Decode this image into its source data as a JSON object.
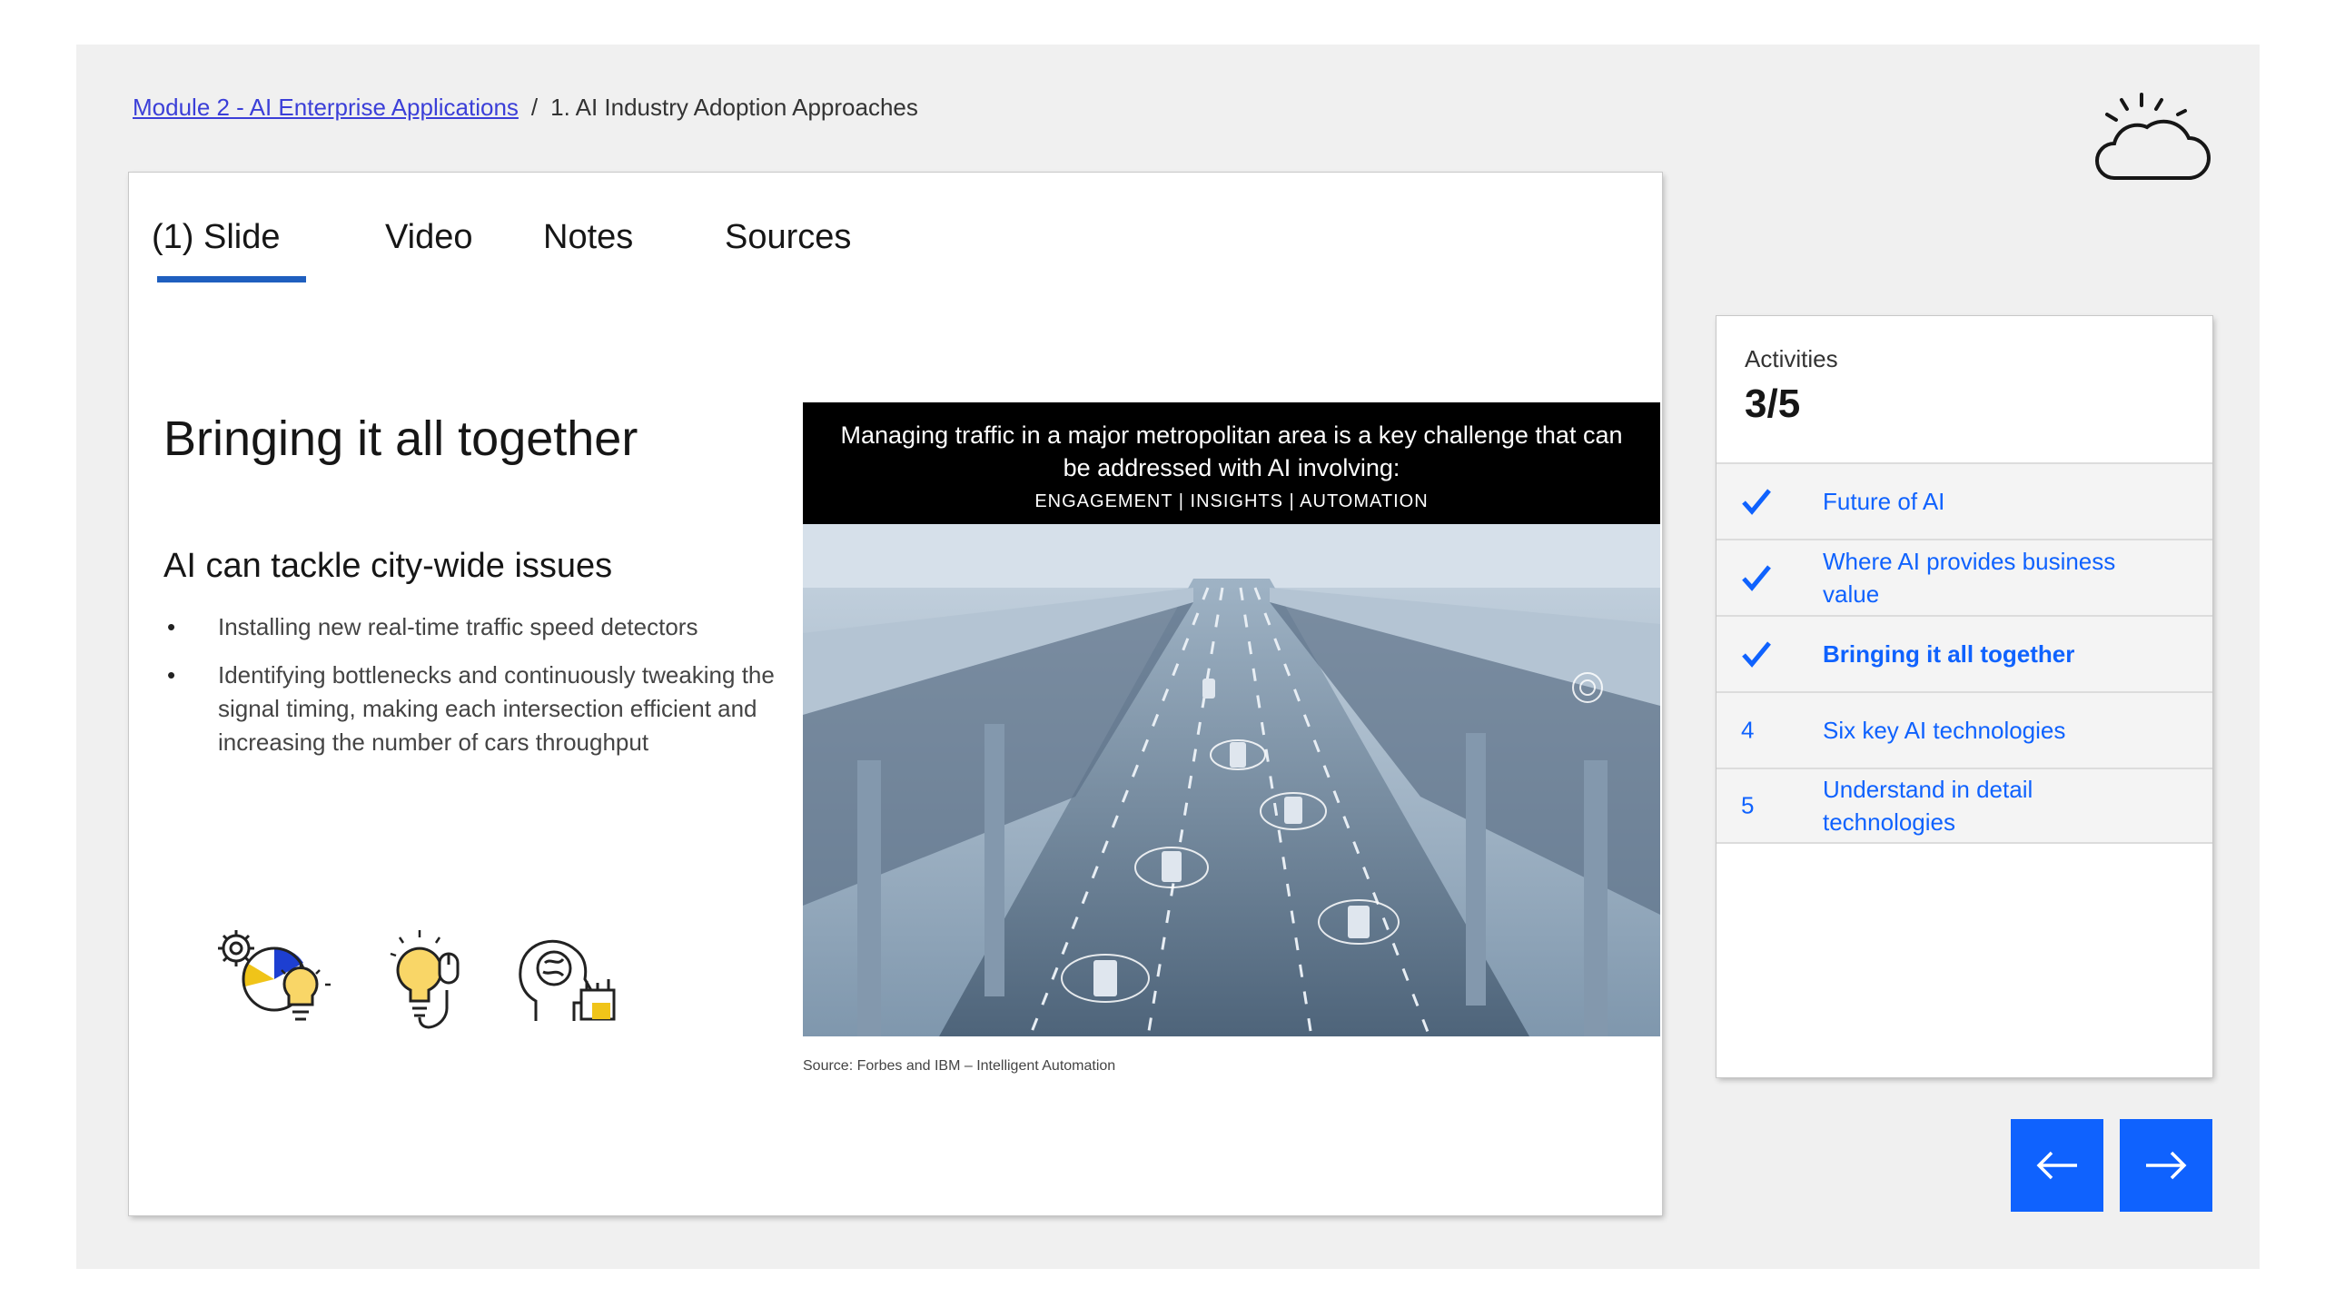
{
  "breadcrumb": {
    "module_link": "Module 2 - AI Enterprise Applications",
    "separator": "/",
    "current": "1. AI Industry Adoption Approaches"
  },
  "tabs": [
    {
      "label": "(1) Slide",
      "active": true
    },
    {
      "label": "Video",
      "active": false
    },
    {
      "label": "Notes",
      "active": false
    },
    {
      "label": "Sources",
      "active": false
    }
  ],
  "slide": {
    "title": "Bringing it all together",
    "subtitle": "AI can tackle city-wide issues",
    "bullets": [
      "Installing new real-time traffic speed detectors",
      "Identifying bottlenecks and continuously tweaking the signal timing, making each intersection efficient and increasing the number of cars throughput"
    ],
    "image_caption_line1": "Managing traffic in a major metropolitan area is a key challenge that can be addressed with AI involving:",
    "image_caption_line2": "ENGAGEMENT  |  INSIGHTS  |  AUTOMATION",
    "source": "Source: Forbes and IBM – Intelligent Automation",
    "icons": [
      "gears-pie-lightbulb-icon",
      "lightbulb-mouse-icon",
      "brain-head-chart-icon"
    ]
  },
  "activities": {
    "label": "Activities",
    "count": "3/5",
    "items": [
      {
        "marker": "check",
        "label": "Future of AI"
      },
      {
        "marker": "check",
        "label": "Where AI provides business value"
      },
      {
        "marker": "check",
        "label": "Bringing it all together",
        "current": true
      },
      {
        "marker": "4",
        "label": "Six key AI technologies"
      },
      {
        "marker": "5",
        "label": "Understand in detail technologies"
      }
    ]
  },
  "nav": {
    "prev_icon": "arrow-left-icon",
    "next_icon": "arrow-right-icon"
  },
  "colors": {
    "accent": "#0f62fe",
    "tab_underline": "#1f5fbf",
    "stage_bg": "#f0f0f0"
  }
}
